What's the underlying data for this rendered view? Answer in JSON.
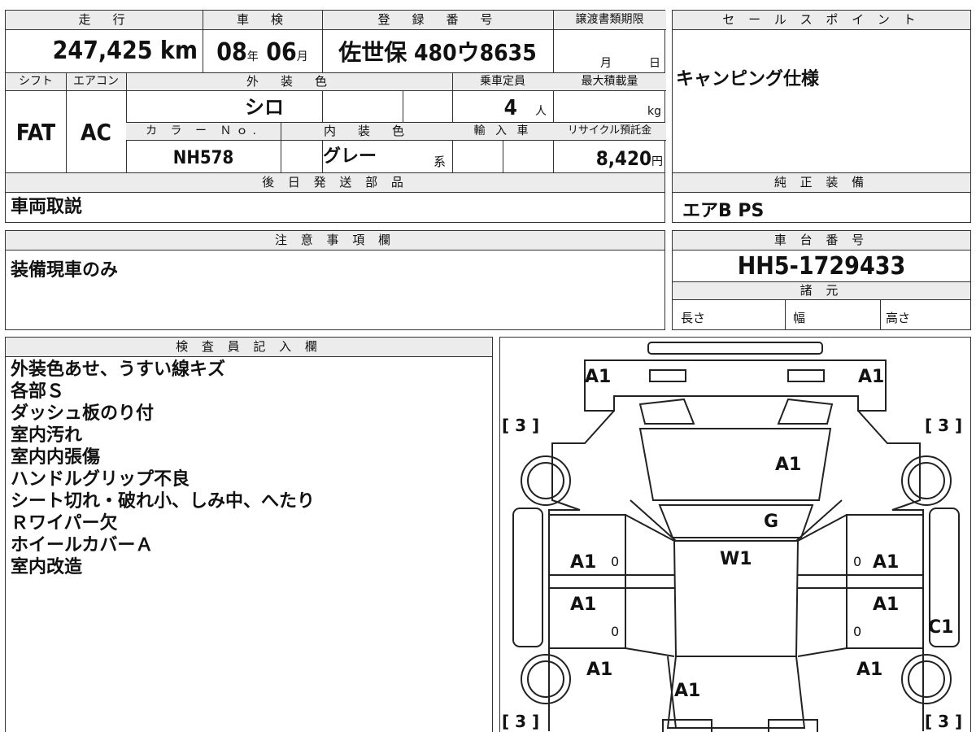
{
  "labels": {
    "mileage": "走　行",
    "shaken": "車　検",
    "reg_no": "登　録　番　号",
    "doc_deadline": "譲渡書類期限",
    "sales_point": "セ ー ル ス ポ イ ン ト",
    "shift": "シフト",
    "aircon": "エアコン",
    "exterior_color": "外　装　色",
    "capacity": "乗車定員",
    "max_load": "最大積載量",
    "color_no": "カ ラ ー Ｎｏ.",
    "interior_color": "内　装　色",
    "import": "輸 入 車",
    "recycle": "リサイクル預託金",
    "later_parts": "後 日 発 送 部 品",
    "genuine_equipment": "純 正 装 備",
    "notes": "注 意 事 項 欄",
    "chassis_no": "車 台 番 号",
    "specs": "諸 元",
    "length": "長さ",
    "width": "幅",
    "height": "高さ",
    "inspector": "検 査 員 記 入 欄"
  },
  "values": {
    "mileage": "247,425",
    "mileage_unit": "km",
    "shaken_year": "08",
    "shaken_year_unit": "年",
    "shaken_month": "06",
    "shaken_month_unit": "月",
    "reg_no": "佐世保 480ウ8635",
    "deadline_month_unit": "月",
    "deadline_day_unit": "日",
    "sales_point": "キャンピング仕様",
    "shift": "FAT",
    "aircon": "AC",
    "exterior_color": "シロ",
    "capacity": "4",
    "capacity_unit": "人",
    "max_load_unit": "kg",
    "color_no": "NH578",
    "interior_color": "グレー",
    "interior_suffix": "系",
    "recycle": "8,420",
    "recycle_unit": "円",
    "later_parts": "車両取説",
    "genuine_equipment": "エアB PS",
    "notes": "装備現車のみ",
    "chassis_no": "HH5-1729433"
  },
  "inspector_notes": [
    "外装色あせ、うすい線キズ",
    "各部Ｓ",
    "ダッシュ板のり付",
    "室内汚れ",
    "室内内張傷",
    "ハンドルグリップ不良",
    "シート切れ・破れ小、しみ中、へたり",
    "Ｒワイパー欠",
    "ホイールカバーＡ",
    "室内改造"
  ],
  "diagram": {
    "front_left": "A1",
    "front_right": "A1",
    "bracket_tl": "[ 3 ]",
    "bracket_tr": "[ 3 ]",
    "bracket_bl": "[ 3 ]",
    "bracket_br": "[ 3 ]",
    "hood": "A1",
    "windshield": "G",
    "roof": "W1",
    "left_front_door": "A1",
    "right_front_door": "A1",
    "left_rear_door": "A1",
    "right_rear_door": "A1",
    "left_rear": "A1",
    "right_rear": "A1",
    "rear": "A1",
    "right_step": "C1",
    "zero": "0"
  }
}
